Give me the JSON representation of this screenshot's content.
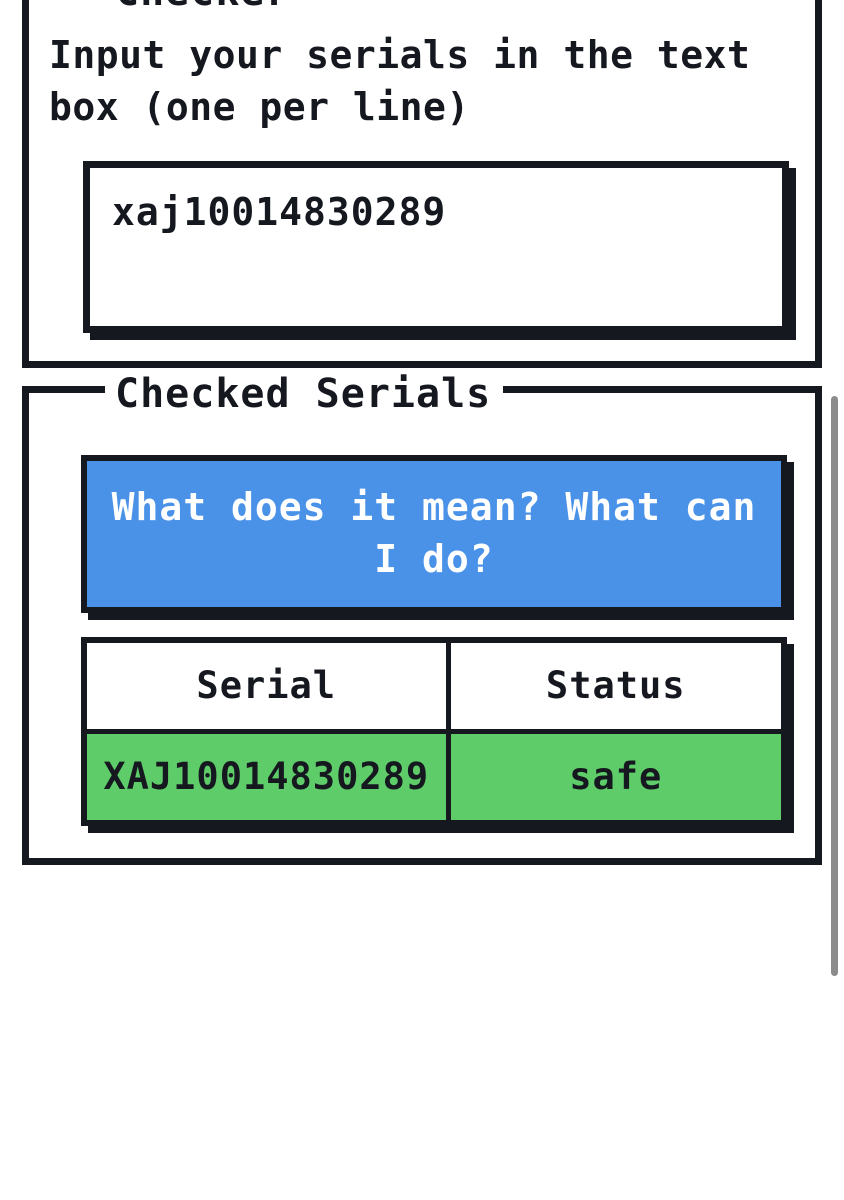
{
  "app": {
    "background_color": "#ffffff",
    "ink_color": "#15191f",
    "accent_blue": "#4a92e8",
    "accent_green": "#5fcc6a"
  },
  "checker_panel": {
    "legend": "Checker",
    "helper_text": "Input your serials in the text box (one per line)",
    "serial_input": {
      "value": "xaj10014830289",
      "placeholder": ""
    }
  },
  "results_panel": {
    "legend": "Checked Serials",
    "info_button": {
      "label": "What does it mean? What can I do?",
      "background": "#4a92e8",
      "text_color": "#ffffff"
    },
    "table": {
      "columns": [
        "Serial",
        "Status"
      ],
      "rows": [
        {
          "serial": "XAJ10014830289",
          "status": "safe",
          "row_color": "#5fcc6a"
        }
      ]
    }
  },
  "scrollbar": {
    "thumb_color": "#8c8c8c",
    "orientation": "vertical"
  }
}
